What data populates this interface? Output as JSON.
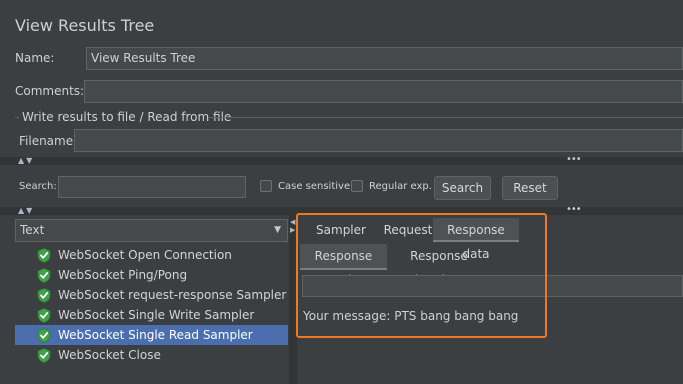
{
  "title": "View Results Tree",
  "name": {
    "label": "Name:",
    "value": "View Results Tree"
  },
  "comments": {
    "label": "Comments:",
    "value": ""
  },
  "file_group": {
    "legend": "Write results to file / Read from file",
    "filename_label": "Filename",
    "filename_value": ""
  },
  "search": {
    "label": "Search:",
    "value": "",
    "case_sensitive_label": "Case sensitive",
    "regex_label": "Regular exp.",
    "search_button": "Search",
    "reset_button": "Reset"
  },
  "renderer": {
    "selected": "Text"
  },
  "tree": {
    "items": [
      {
        "label": "WebSocket Open Connection",
        "status": "success",
        "selected": false
      },
      {
        "label": "WebSocket Ping/Pong",
        "status": "success",
        "selected": false
      },
      {
        "label": "WebSocket request-response Sampler",
        "status": "success",
        "selected": false
      },
      {
        "label": "WebSocket Single Write Sampler",
        "status": "success",
        "selected": false
      },
      {
        "label": "WebSocket Single Read Sampler",
        "status": "success",
        "selected": true
      },
      {
        "label": "WebSocket Close",
        "status": "success",
        "selected": false
      }
    ]
  },
  "result_tabs": {
    "tabs": [
      "Sampler result",
      "Request",
      "Response data"
    ],
    "selected": "Response data"
  },
  "response_tabs": {
    "tabs": [
      "Response Body",
      "Response headers"
    ],
    "selected": "Response Body"
  },
  "response_body": {
    "search_value": "",
    "text": "Your message: PTS bang bang bang"
  },
  "colors": {
    "background": "#3c3f41",
    "selection": "#4b6eaf",
    "highlight_border": "#f07820",
    "success_icon": "#3fa04a"
  }
}
